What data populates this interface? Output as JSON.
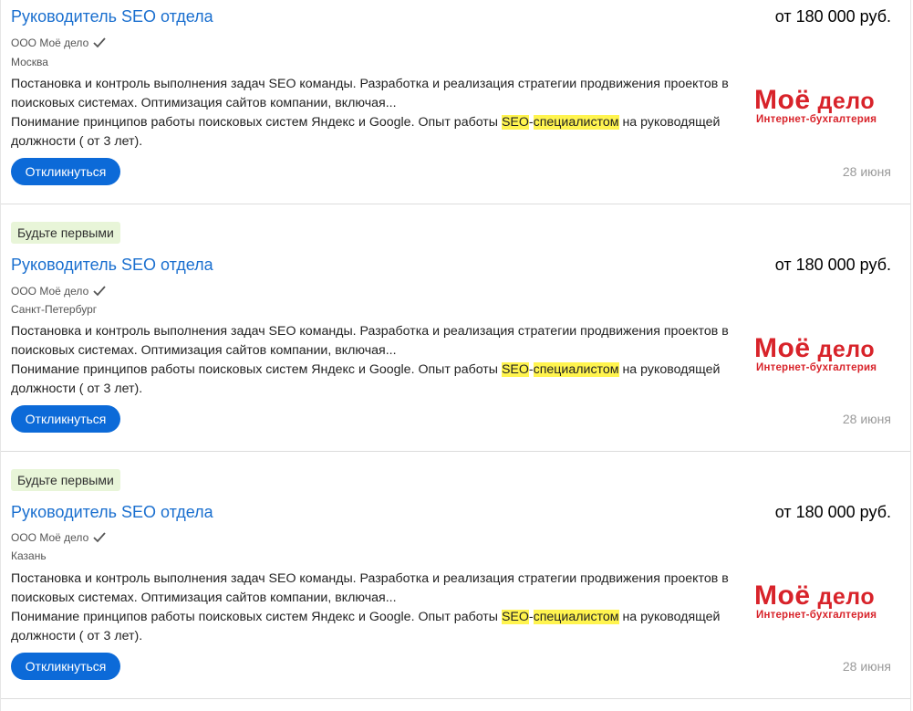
{
  "vacancies": [
    {
      "badge": "",
      "title": "Руководитель SEO отдела",
      "salary": "от 180 000 руб.",
      "company": "ООО Моё дело",
      "city": "Москва",
      "desc_line1": "Постановка и контроль выполнения задач SEO команды. Разработка и реализация стратегии продвижения проектов в поисковых системах. Оптимизация сайтов компании, включая...",
      "desc_line2_pre": "Понимание принципов работы поисковых систем Яндекс и Google. Опыт работы ",
      "hl_seo": "SEO",
      "hl_dash": "-",
      "hl_spec": "специалистом",
      "desc_line2_post": " на руководящей должности ( от 3 лет).",
      "logo_main": "Моё",
      "logo_main2": "дело",
      "logo_sub": "Интернет-бухгалтерия",
      "button": "Откликнуться",
      "date": "28 июня"
    },
    {
      "badge": "Будьте первыми",
      "title": "Руководитель SEO отдела",
      "salary": "от 180 000 руб.",
      "company": "ООО Моё дело",
      "city": "Санкт-Петербург",
      "desc_line1": "Постановка и контроль выполнения задач SEO команды. Разработка и реализация стратегии продвижения проектов в поисковых системах. Оптимизация сайтов компании, включая...",
      "desc_line2_pre": "Понимание принципов работы поисковых систем Яндекс и Google. Опыт работы ",
      "hl_seo": "SEO",
      "hl_dash": "-",
      "hl_spec": "специалистом",
      "desc_line2_post": " на руководящей должности ( от 3 лет).",
      "logo_main": "Моё",
      "logo_main2": "дело",
      "logo_sub": "Интернет-бухгалтерия",
      "button": "Откликнуться",
      "date": "28 июня"
    },
    {
      "badge": "Будьте первыми",
      "title": "Руководитель SEO отдела",
      "salary": "от 180 000 руб.",
      "company": "ООО Моё дело",
      "city": "Казань",
      "desc_line1": "Постановка и контроль выполнения задач SEO команды. Разработка и реализация стратегии продвижения проектов в поисковых системах. Оптимизация сайтов компании, включая...",
      "desc_line2_pre": "Понимание принципов работы поисковых систем Яндекс и Google. Опыт работы ",
      "hl_seo": "SEO",
      "hl_dash": "-",
      "hl_spec": "специалистом",
      "desc_line2_post": " на руководящей должности ( от 3 лет).",
      "logo_main": "Моё",
      "logo_main2": "дело",
      "logo_sub": "Интернет-бухгалтерия",
      "button": "Откликнуться",
      "date": "28 июня"
    }
  ],
  "colors": {
    "link": "#1a6fcf",
    "button": "#0c6ad8",
    "badge_bg": "#e8f5d8",
    "highlight": "#fff44f",
    "logo_red": "#d8232a"
  }
}
